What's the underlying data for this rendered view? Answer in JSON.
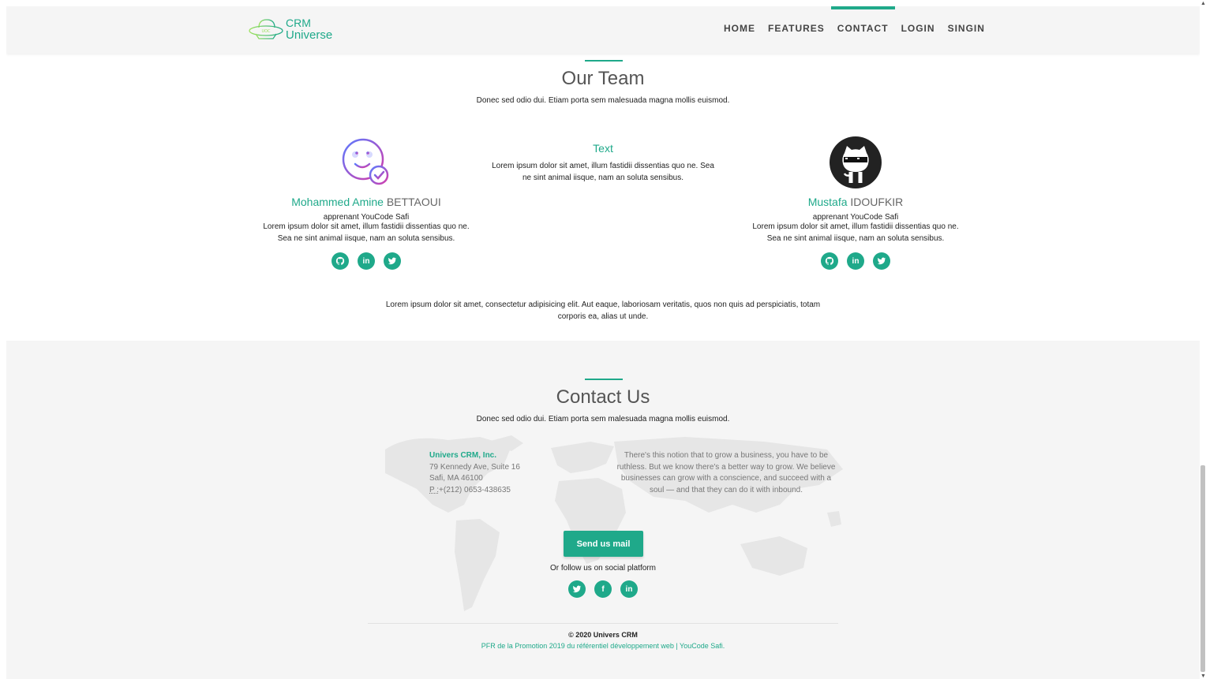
{
  "colors": {
    "accent": "#1fa98a",
    "text": "#222222",
    "muted": "#777777",
    "navbar_bg": "#f5f5f5",
    "contact_bg": "#f5f5f5"
  },
  "brand": {
    "line1": "CRM",
    "line2": "Universe",
    "icon": "ufo-logo-icon"
  },
  "nav": {
    "items": [
      {
        "label": "HOME"
      },
      {
        "label": "FEATURES"
      },
      {
        "label": "CONTACT",
        "active": true
      },
      {
        "label": "LOGIN"
      },
      {
        "label": "SINGIN"
      }
    ]
  },
  "team": {
    "title": "Our Team",
    "subtitle": "Donec sed odio dui. Etiam porta sem malesuada magna mollis euismod.",
    "members": [
      {
        "first_name": "Mohammed Amine",
        "last_name": "BETTAOUI",
        "role": "apprenant YouCode Safi",
        "description": "Lorem ipsum dolor sit amet, illum fastidii dissentias quo ne. Sea ne sint animal iisque, nam an soluta sensibus.",
        "avatar_icon": "smiley-check-icon",
        "socials": [
          {
            "icon": "github-icon"
          },
          {
            "icon": "linkedin-icon"
          },
          {
            "icon": "twitter-icon"
          }
        ]
      },
      {
        "first_name": "Mustafa",
        "last_name": "IDOUFKIR",
        "role": "apprenant YouCode Safi",
        "description": "Lorem ipsum dolor sit amet, illum fastidii dissentias quo ne. Sea ne sint animal iisque, nam an soluta sensibus.",
        "avatar_icon": "github-octocat-sunglasses-icon",
        "socials": [
          {
            "icon": "github-icon"
          },
          {
            "icon": "linkedin-icon"
          },
          {
            "icon": "twitter-icon"
          }
        ]
      }
    ],
    "middle": {
      "title": "Text",
      "description": "Lorem ipsum dolor sit amet, illum fastidii dissentias quo ne. Sea ne sint animal iisque, nam an soluta sensibus."
    },
    "footer_text": "Lorem ipsum dolor sit amet, consectetur adipisicing elit. Aut eaque, laboriosam veritatis, quos non quis ad perspiciatis, totam corporis ea, alias ut unde."
  },
  "contact": {
    "title": "Contact Us",
    "subtitle": "Donec sed odio dui. Etiam porta sem malesuada magna mollis euismod.",
    "company": "Univers CRM, Inc.",
    "street": "79 Kennedy Ave, Suite 16",
    "city": "Safi, MA 46100",
    "phone_label": "P :",
    "phone": "+(212) 0653-438635",
    "notion": "There's this notion that to grow a business, you have to be ruthless. But we know there's a better way to grow. We believe businesses can grow with a conscience, and succeed with a soul — and that they can do it with inbound.",
    "send_button": "Send us mail",
    "follow_text": "Or follow us on social platform",
    "socials": [
      {
        "icon": "twitter-icon"
      },
      {
        "icon": "facebook-icon"
      },
      {
        "icon": "linkedin-icon"
      }
    ],
    "background_icon": "world-map-icon"
  },
  "footer": {
    "copyright": "© 2020 Univers CRM",
    "credits": "PFR de la Promotion 2019 du référentiel développement web | YouCode Safi."
  }
}
